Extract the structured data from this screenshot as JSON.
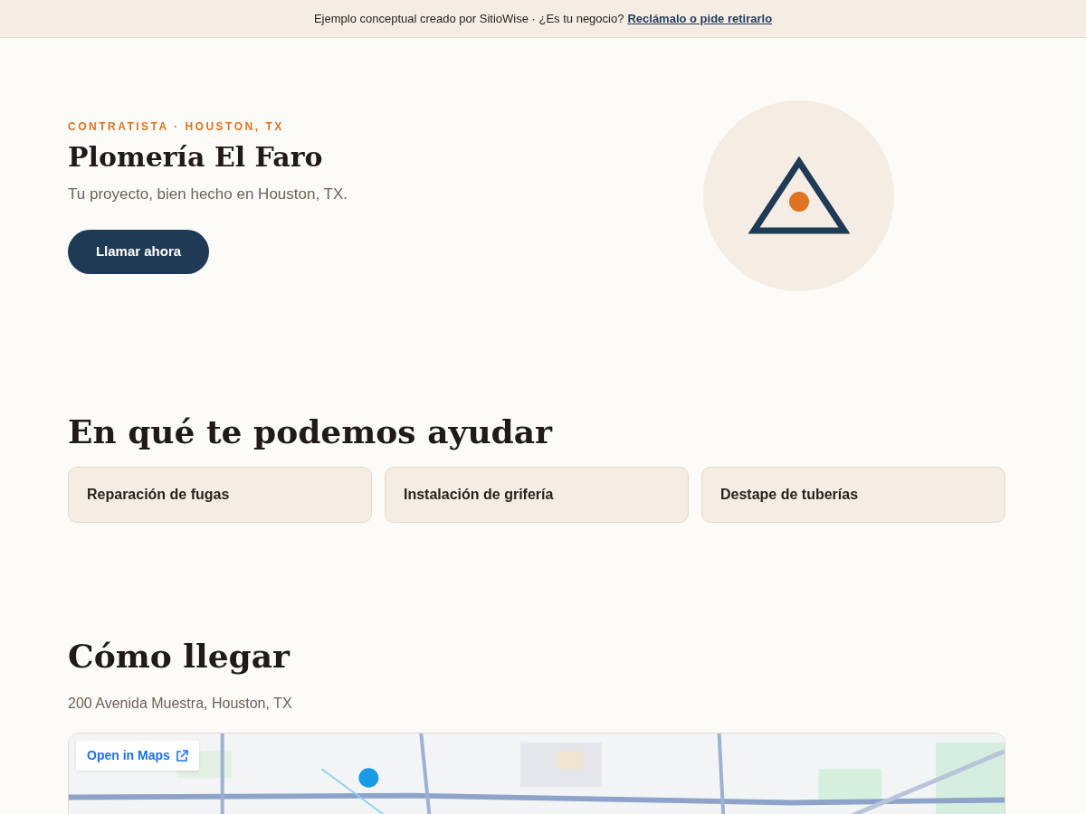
{
  "banner": {
    "text": "Ejemplo conceptual creado por SitioWise · ¿Es tu negocio?",
    "link": "Reclámalo o pide retirarlo"
  },
  "hero": {
    "eyebrow": "CONTRATISTA · HOUSTON, TX",
    "title": "Plomería El Faro",
    "subtitle": "Tu proyecto, bien hecho en Houston, TX.",
    "button": "Llamar ahora"
  },
  "services": {
    "heading": "En qué te podemos ayudar",
    "items": [
      {
        "label": "Reparación de fugas"
      },
      {
        "label": "Instalación de grifería"
      },
      {
        "label": "Destape de tuberías"
      }
    ]
  },
  "location": {
    "heading": "Cómo llegar",
    "address": "200 Avenida Muestra, Houston, TX",
    "map": {
      "kind": "picture",
      "button": "Open in Maps"
    }
  }
}
